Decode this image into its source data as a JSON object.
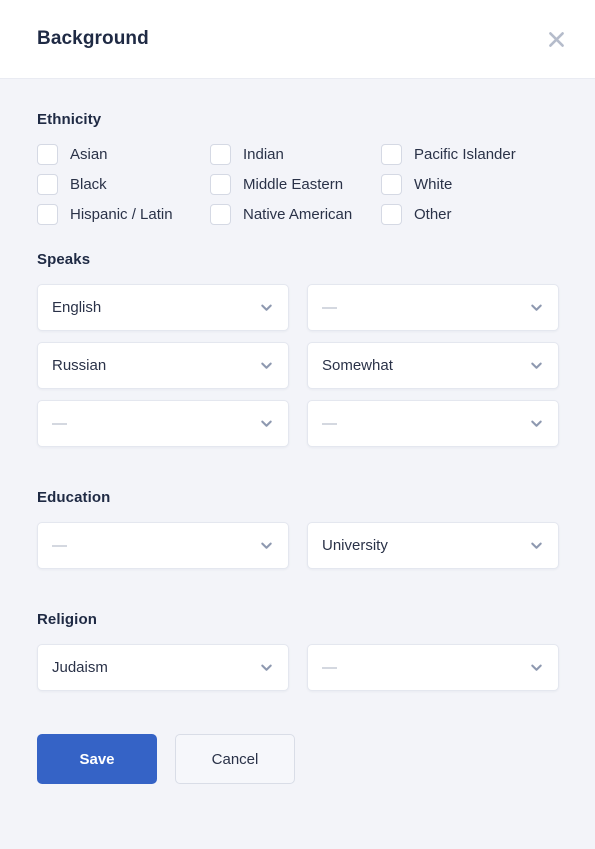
{
  "header": {
    "title": "Background",
    "close_icon": "close-icon"
  },
  "sections": {
    "ethnicity": {
      "title": "Ethnicity",
      "options": [
        {
          "label": "Asian",
          "checked": false
        },
        {
          "label": "Indian",
          "checked": false
        },
        {
          "label": "Pacific Islander",
          "checked": false
        },
        {
          "label": "Black",
          "checked": false
        },
        {
          "label": "Middle Eastern",
          "checked": false
        },
        {
          "label": "White",
          "checked": false
        },
        {
          "label": "Hispanic / Latin",
          "checked": false
        },
        {
          "label": "Native American",
          "checked": false
        },
        {
          "label": "Other",
          "checked": false
        }
      ]
    },
    "speaks": {
      "title": "Speaks",
      "placeholder": "—",
      "rows": [
        {
          "language": "English",
          "level": "—",
          "language_is_placeholder": false,
          "level_is_placeholder": true
        },
        {
          "language": "Russian",
          "level": "Somewhat",
          "language_is_placeholder": false,
          "level_is_placeholder": false
        },
        {
          "language": "—",
          "level": "—",
          "language_is_placeholder": true,
          "level_is_placeholder": true
        }
      ]
    },
    "education": {
      "title": "Education",
      "row": {
        "left": "—",
        "right": "University",
        "left_is_placeholder": true,
        "right_is_placeholder": false
      }
    },
    "religion": {
      "title": "Religion",
      "row": {
        "left": "Judaism",
        "right": "—",
        "left_is_placeholder": false,
        "right_is_placeholder": true
      }
    }
  },
  "footer": {
    "save_label": "Save",
    "cancel_label": "Cancel"
  },
  "colors": {
    "accent": "#3563c6",
    "background": "#f3f4f9",
    "surface": "#ffffff",
    "text": "#1f2a44",
    "placeholder": "#a9b0c2",
    "border": "#e4e7ef"
  }
}
